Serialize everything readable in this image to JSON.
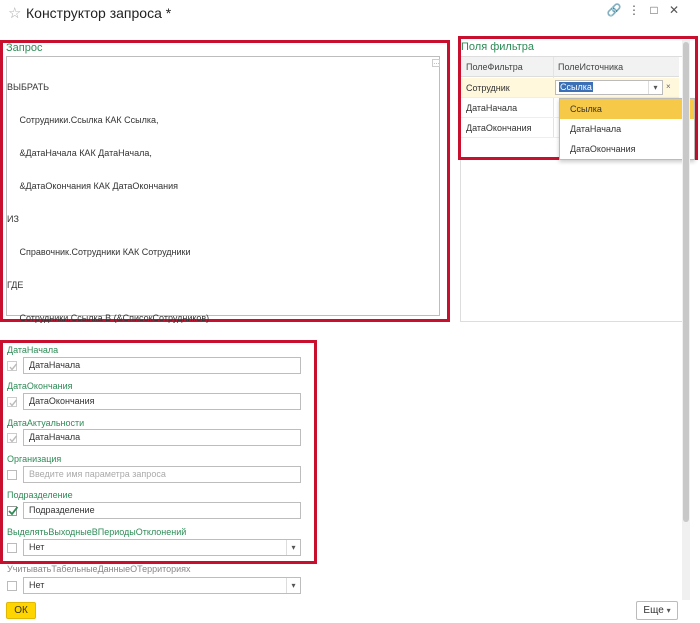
{
  "window": {
    "title": "Конструктор запроса *",
    "icons": [
      "star-icon",
      "link-icon",
      "more-icon",
      "restore-icon",
      "close-icon"
    ]
  },
  "query_panel": {
    "label": "Запрос",
    "lines": [
      "ВЫБРАТЬ",
      "     Сотрудники.Ссылка КАК Ссылка,",
      "     &ДатаНачала КАК ДатаНачала,",
      "     &ДатаОкончания КАК ДатаОкончания",
      "ИЗ",
      "     Справочник.Сотрудники КАК Сотрудники",
      "ГДЕ",
      "     Сотрудники.Ссылка В (&СписокСотрудников)"
    ]
  },
  "filter_panel": {
    "label": "Поля фильтра",
    "columns": [
      "ПолеФильтра",
      "ПолеИсточника"
    ],
    "rows": [
      {
        "field": "Сотрудник",
        "source": "Ссылка"
      },
      {
        "field": "ДатаНачала",
        "source": ""
      },
      {
        "field": "ДатаОкончания",
        "source": ""
      }
    ],
    "dropdown": [
      "Ссылка",
      "ДатаНачала",
      "ДатаОкончания"
    ],
    "dropdown_selected": "Ссылка"
  },
  "params": [
    {
      "label": "ДатаНачала",
      "checked": true,
      "value": "ДатаНачала",
      "placeholder": ""
    },
    {
      "label": "ДатаОкончания",
      "checked": true,
      "value": "ДатаОкончания",
      "placeholder": ""
    },
    {
      "label": "ДатаАктуальности",
      "checked": true,
      "value": "ДатаНачала",
      "placeholder": ""
    },
    {
      "label": "Организация",
      "checked": false,
      "value": "",
      "placeholder": "Введите имя параметра запроса"
    },
    {
      "label": "Подразделение",
      "checked": true,
      "value": "Подразделение",
      "placeholder": ""
    },
    {
      "label": "ВыделятьВыходныеВПериодыОтклонений",
      "checked": false,
      "value": "Нет",
      "placeholder": ""
    },
    {
      "label": "УчитыватьТабельныеДанныеОТерриториях",
      "checked": false,
      "value": "Нет",
      "placeholder": ""
    }
  ],
  "buttons": {
    "ok": "ОК",
    "more": "Еще"
  },
  "colors": {
    "accent_green": "#2e8b57",
    "highlight_red": "#c8102e",
    "ok_yellow": "#ffd500",
    "selected_item": "#f7c948"
  }
}
